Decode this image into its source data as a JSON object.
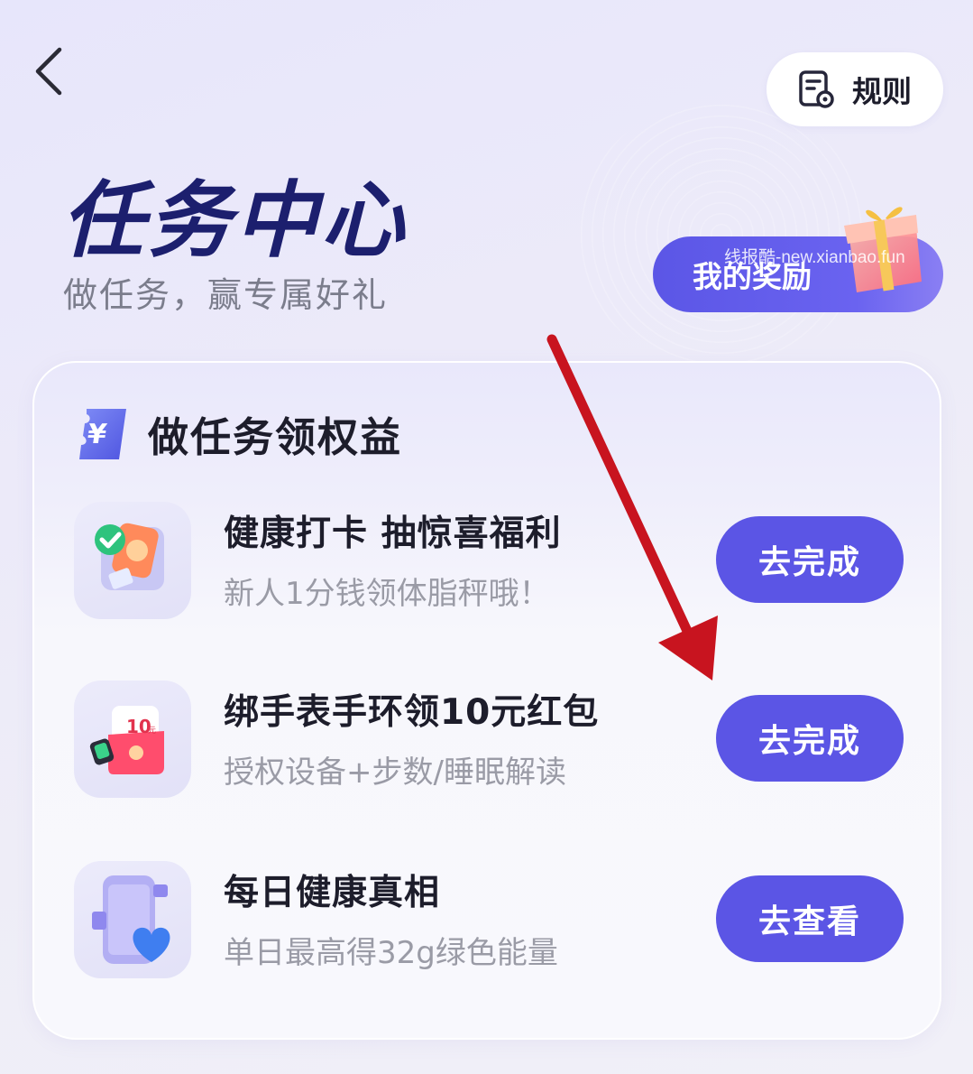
{
  "header": {
    "back_icon": "chevron-left-icon",
    "rules_label": "规则",
    "rules_icon": "document-settings-icon"
  },
  "hero": {
    "title": "任务中心",
    "subtitle": "做任务，赢专属好礼",
    "reward_label": "我的奖励",
    "reward_icon": "gift-box-icon",
    "watermark": "线报酷-new.xianbao.fun"
  },
  "card": {
    "title": "做任务领权益",
    "title_icon": "yuan-coupon-icon",
    "tasks": [
      {
        "title": "健康打卡 抽惊喜福利",
        "desc": "新人1分钱领体脂秤哦！",
        "button": "去完成",
        "icon": "health-checkin-icon"
      },
      {
        "title": "绑手表手环领10元红包",
        "desc": "授权设备+步数/睡眠解读",
        "button": "去完成",
        "icon": "red-envelope-watch-icon",
        "icon_text": "10",
        "icon_unit": "元"
      },
      {
        "title": "每日健康真相",
        "desc": "单日最高得32g绿色能量",
        "button": "去查看",
        "icon": "phone-heart-icon"
      }
    ]
  },
  "colors": {
    "accent": "#5b55e5",
    "title_navy": "#1c1f6e",
    "annotation_arrow": "#c8141f"
  }
}
